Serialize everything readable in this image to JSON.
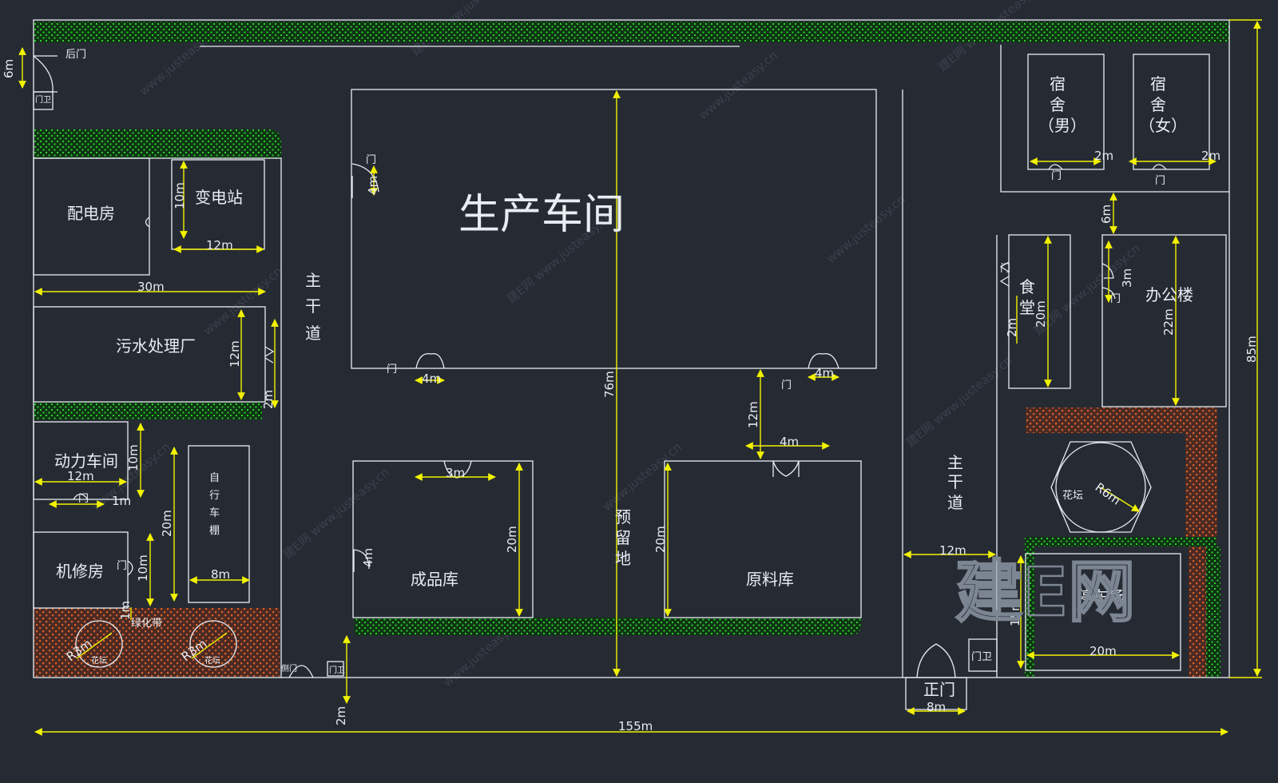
{
  "plan": {
    "back_gate": "后门",
    "guard": "门卫",
    "door": "门",
    "side_gate": "侧门",
    "main_gate": "正门",
    "main_road_1": [
      "主",
      "干",
      "道"
    ],
    "main_road_2": [
      "主",
      "干",
      "道"
    ],
    "reserved_land": [
      "预",
      "留",
      "地"
    ],
    "flower_bed": "花坛",
    "greenbelt": "绿化带"
  },
  "buildings": {
    "power_room": "配电房",
    "substation": "变电站",
    "sewage": "污水处理厂",
    "power_workshop": "动力车间",
    "bike_shed": [
      "自",
      "行",
      "车",
      "棚"
    ],
    "repair": "机修房",
    "production": "生产车间",
    "finished": "成品库",
    "raw": "原料库",
    "dorm_m": [
      "宿",
      "舍",
      "（男）"
    ],
    "dorm_f": [
      "宿",
      "舍",
      "（女）"
    ],
    "canteen": [
      "食",
      "堂"
    ],
    "office": "办公楼",
    "parking": "停车场"
  },
  "dims": {
    "d6m_top": "6m",
    "d10m_sub": "10m",
    "d12m_sub": "12m",
    "d30m": "30m",
    "d12m_sew": "12m",
    "d2m_sew": "2m",
    "d10m_pw": "10m",
    "d12m_pw": "12m",
    "d1m": "1m",
    "d20m_bike": "20m",
    "d8m_bike": "8m",
    "d10m_rep": "10m",
    "d1m_v": "1m",
    "r3m_a": "R3m",
    "r3m_b": "R3m",
    "d2m_bottom": "2m",
    "d155m": "155m",
    "d4m_prod_door": "4m",
    "d4m_a": "4m",
    "d4m_b": "4m",
    "d76m": "76m",
    "d12m_mid": "12m",
    "d4m_raw": "4m",
    "d3m_fin": "3m",
    "d4m_fin": "4m",
    "d20m_fin": "20m",
    "d20m_raw": "20m",
    "d2m_dm": "2m",
    "d2m_df": "2m",
    "d6m_mid": "6m",
    "d3m_off": "3m",
    "d2m_can": "2m",
    "d20m_can": "20m",
    "d22m_off": "22m",
    "r6m": "R6m",
    "d12m_right": "12m",
    "d15m_park": "15m",
    "d20m_park": "20m",
    "d8m_gate": "8m",
    "d85m": "85m"
  },
  "watermark": {
    "url": "www.justeasy.cn",
    "cn": "建E网",
    "brand": "建E网"
  },
  "colors": {
    "background": "#262b33",
    "line": "#e9edf2",
    "dimension": "#f2f200",
    "green": "#00b400",
    "orange": "#c8501e"
  }
}
